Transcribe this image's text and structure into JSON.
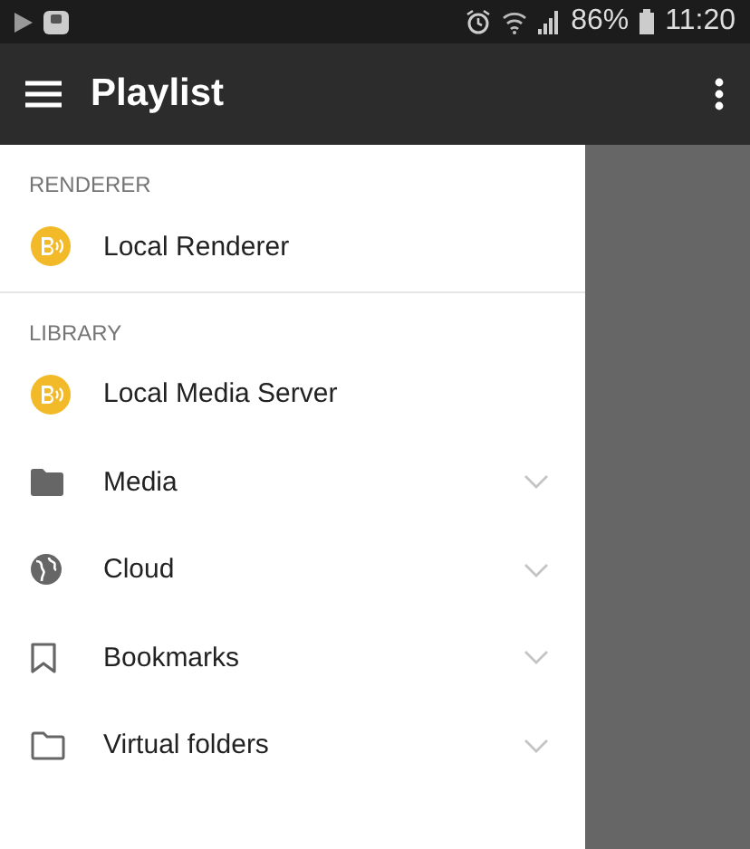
{
  "status_bar": {
    "battery": "86%",
    "time": "11:20"
  },
  "app_bar": {
    "title": "Playlist"
  },
  "drawer": {
    "sections": [
      {
        "header": "RENDERER",
        "items": [
          {
            "kind": "renderer",
            "label": "Local Renderer"
          }
        ]
      },
      {
        "header": "LIBRARY",
        "items": [
          {
            "kind": "renderer",
            "label": "Local Media Server"
          },
          {
            "kind": "folder",
            "label": "Media",
            "expanded": false
          },
          {
            "kind": "globe",
            "label": "Cloud",
            "expanded": false
          },
          {
            "kind": "bookmark",
            "label": "Bookmarks",
            "expanded": false
          },
          {
            "kind": "folder-outline",
            "label": "Virtual folders",
            "expanded": false
          }
        ]
      }
    ]
  }
}
